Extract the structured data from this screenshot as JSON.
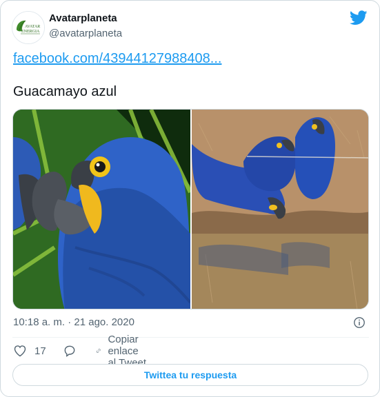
{
  "author": {
    "name": "Avatarplaneta",
    "handle": "@avatarplaneta",
    "avatar_text_1": "AVATAR",
    "avatar_text_2": "ENERGIA"
  },
  "tweet": {
    "link": "facebook.com/43944127988408...",
    "text": "Guacamayo azul",
    "timestamp": "10:18 a. m. · 21 ago. 2020"
  },
  "actions": {
    "like_count": "17",
    "copy_link_label": "Copiar enlace al Tweet",
    "reply_button_label": "Twittea tu respuesta"
  },
  "colors": {
    "accent": "#1d9bf0",
    "secondary_text": "#536471"
  }
}
